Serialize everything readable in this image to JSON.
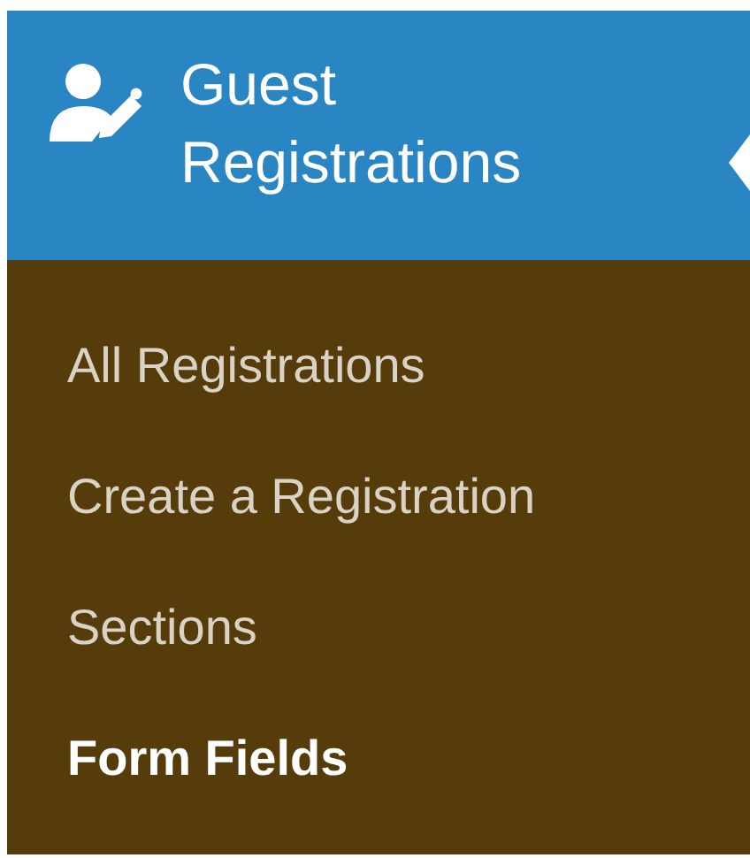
{
  "menu": {
    "title": "Guest Registrations",
    "expanded": true,
    "items": [
      {
        "label": "All Registrations",
        "selected": false
      },
      {
        "label": "Create a Registration",
        "selected": false
      },
      {
        "label": "Sections",
        "selected": false
      },
      {
        "label": "Form Fields",
        "selected": true
      }
    ]
  }
}
